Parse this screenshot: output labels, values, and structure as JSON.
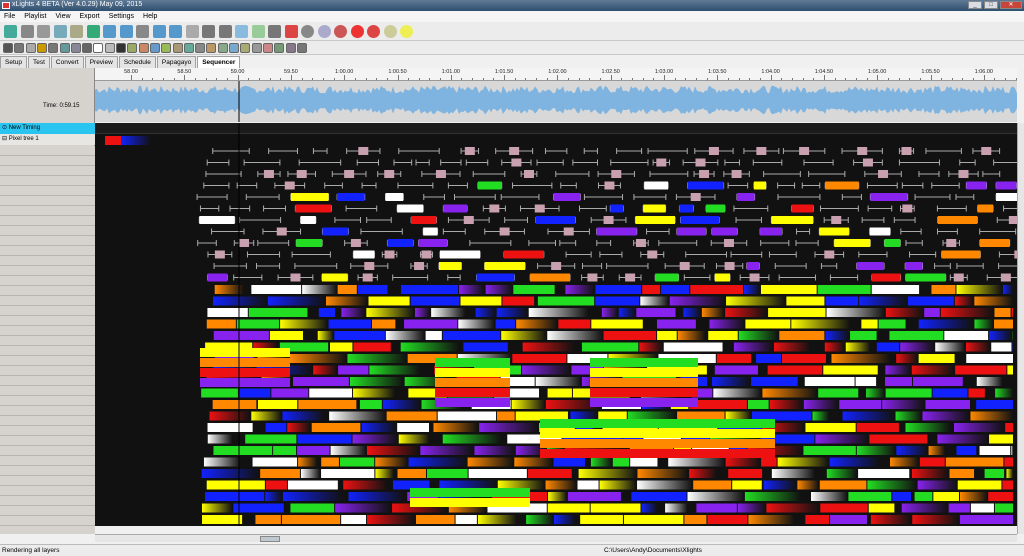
{
  "window": {
    "title": "xLights 4 BETA (Ver 4.0.29) May 09, 2015"
  },
  "menu": [
    "File",
    "Playlist",
    "View",
    "Export",
    "Settings",
    "Help"
  ],
  "tabs": [
    {
      "label": "Setup",
      "active": false
    },
    {
      "label": "Test",
      "active": false
    },
    {
      "label": "Convert",
      "active": false
    },
    {
      "label": "Preview",
      "active": false
    },
    {
      "label": "Schedule",
      "active": false
    },
    {
      "label": "Papagayo",
      "active": false
    },
    {
      "label": "Sequencer",
      "active": true
    }
  ],
  "ruler": [
    "58.00",
    "58.50",
    "59.00",
    "59.50",
    "1:00.00",
    "1:00.50",
    "1:01.00",
    "1:01.50",
    "1:02.00",
    "1:02.50",
    "1:03.00",
    "1:03.50",
    "1:04.00",
    "1:04.50",
    "1:05.00",
    "1:05.50",
    "1:06.00"
  ],
  "time_display": "Time: 0:59.15",
  "rows": {
    "timing": "New Timing",
    "model": "Pixel tree 1"
  },
  "status": {
    "left": "Rendering all layers",
    "path": "C:\\Users\\Andy\\Documents\\Xlights"
  },
  "colors": {
    "yellow": "#ffff00",
    "green": "#22dd22",
    "red": "#ee1111",
    "orange": "#ff8800",
    "purple": "#8822ee",
    "blue": "#1122ff",
    "white": "#ffffff",
    "cyan": "#29c4f0",
    "wave": "#7fb4e0",
    "grid_bg": "#111111"
  }
}
